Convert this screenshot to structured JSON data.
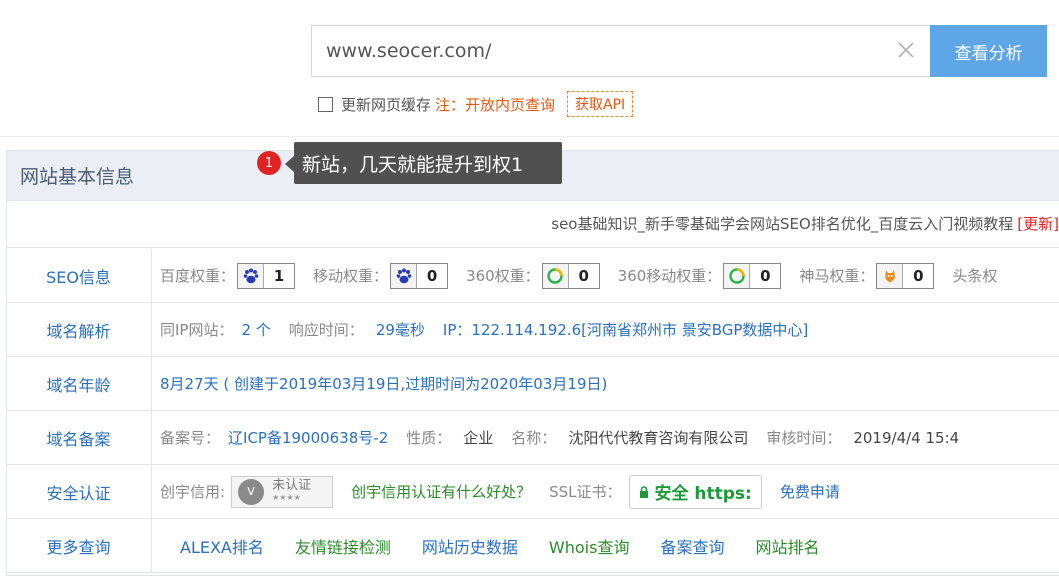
{
  "search": {
    "value": "www.seocer.com/",
    "button_label": "查看分析"
  },
  "options": {
    "cache_label": "更新网页缓存",
    "note": "注：开放内页查询",
    "api_label": "获取API"
  },
  "tooltip": {
    "badge": "1",
    "text": "新站，几天就能提升到权1"
  },
  "panel": {
    "title": "网站基本信息",
    "site_title": "seo基础知识_新手零基础学会网站SEO排名优化_百度云入门视频教程",
    "update_label": "[更新]"
  },
  "seo": {
    "label": "SEO信息",
    "baidu_label": "百度权重：",
    "baidu_value": "1",
    "mobile_label": "移动权重：",
    "mobile_value": "0",
    "s360_label": "360权重：",
    "s360_value": "0",
    "s360m_label": "360移动权重：",
    "s360m_value": "0",
    "shenma_label": "神马权重：",
    "shenma_value": "0",
    "toutiao_label": "头条权"
  },
  "dns": {
    "label": "域名解析",
    "sameip_label": "同IP网站：",
    "sameip_value": "2 个",
    "resp_label": "响应时间：",
    "resp_value": "29毫秒",
    "ip_text": "IP：122.114.192.6[河南省郑州市 景安BGP数据中心]"
  },
  "age": {
    "label": "域名年龄",
    "text": "8月27天 ( 创建于2019年03月19日,过期时间为2020年03月19日)"
  },
  "icp": {
    "label": "域名备案",
    "no_label": "备案号：",
    "no_value": "辽ICP备19000638号-2",
    "type_label": "性质：",
    "type_value": "企业",
    "name_label": "名称：",
    "name_value": "沈阳代代教育咨询有限公司",
    "time_label": "审核时间：",
    "time_value": "2019/4/4 15:4"
  },
  "security": {
    "label": "安全认证",
    "chuangyu_label": "创宇信用:",
    "cert_badge": "未认证",
    "cert_stars": "★★★★",
    "cert_question": "创宇信用认证有什么好处？",
    "ssl_label": "SSL证书：",
    "ssl_badge": "安全 https:",
    "ssl_apply": "免费申请"
  },
  "more": {
    "label": "更多查询",
    "links": [
      "ALEXA排名",
      "友情链接检测",
      "网站历史数据",
      "Whois查询",
      "备案查询",
      "网站排名"
    ]
  },
  "colors": {
    "accent": "#5ea6e6",
    "link_blue": "#2c6fb8",
    "link_green": "#2c8a2c",
    "note_orange": "#e25b14",
    "update_red": "#e02424"
  }
}
